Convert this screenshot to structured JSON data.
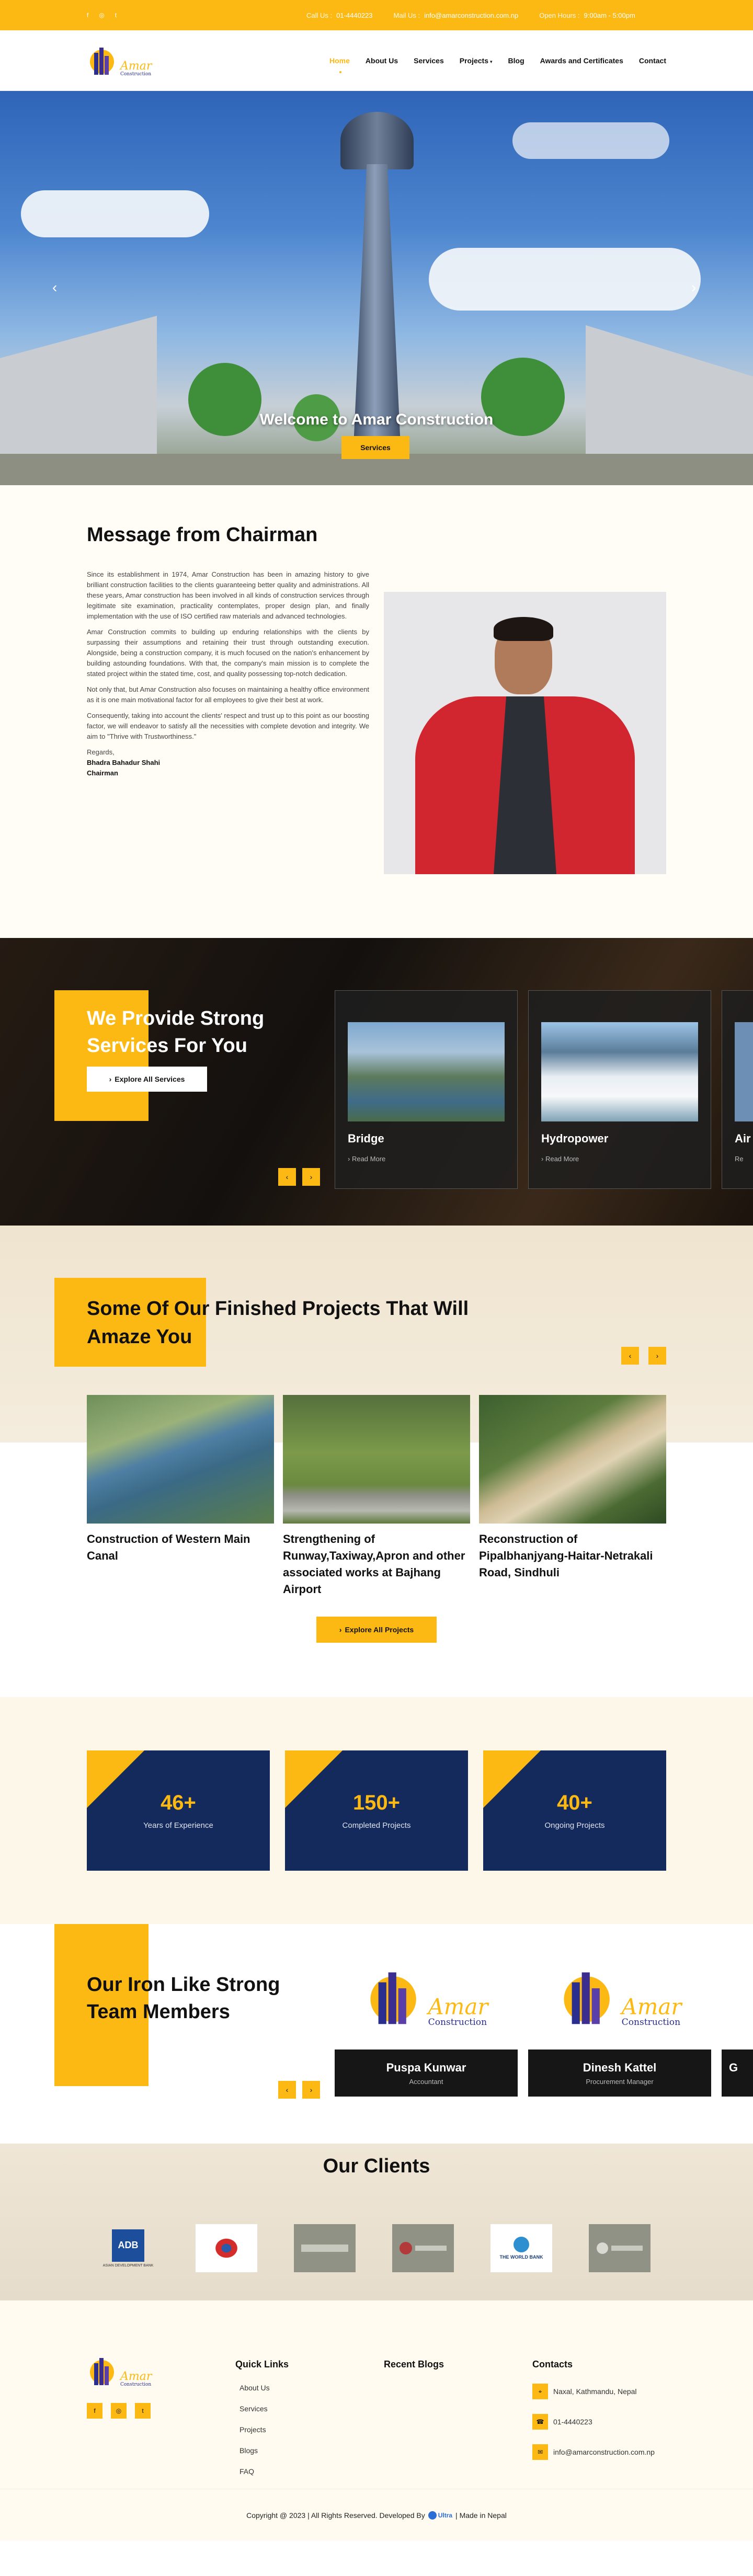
{
  "topbar": {
    "social_icons": [
      "facebook-icon",
      "instagram-icon",
      "twitter-icon"
    ],
    "call_label": "Call Us :",
    "call_value": "01-4440223",
    "mail_label": "Mail Us :",
    "mail_value": "info@amarconstruction.com.np",
    "hours_label": "Open Hours :",
    "hours_value": "9:00am - 5:00pm"
  },
  "brand": {
    "name": "Amar",
    "sub": "Construction"
  },
  "nav": {
    "home": "Home",
    "about": "About Us",
    "services": "Services",
    "projects": "Projects",
    "blog": "Blog",
    "awards": "Awards and Certificates",
    "contact": "Contact"
  },
  "hero": {
    "title": "Welcome to Amar Construction",
    "button": "Services"
  },
  "chairman": {
    "heading": "Message from Chairman",
    "p1": "Since its establishment in 1974, Amar Construction has been in amazing history to give brilliant construction facilities to the clients guaranteeing better quality and administrations. All these years, Amar construction has been involved in all kinds of construction services through legitimate site examination, practicality contemplates, proper design plan, and finally implementation with the use of ISO certified raw materials and advanced technologies.",
    "p2": "Amar Construction commits to building up enduring relationships with the clients by surpassing their assumptions and retaining their trust through outstanding execution. Alongside, being a construction company, it is much focused on the nation's enhancement by building astounding foundations. With that, the company's main mission is to complete the stated project within the stated time, cost, and quality possessing top-notch dedication.",
    "p3": "Not only that, but Amar Construction also focuses on maintaining a healthy office environment as it is one main motivational factor for all employees to give their best at work.",
    "p4": "Consequently, taking into account the clients' respect and trust up to this point as our boosting factor, we will endeavor to satisfy all the necessities with complete devotion and integrity. We aim to \"Thrive with Trustworthiness.\"",
    "regards": "Regards,",
    "name": "Bhadra Bahadur Shahi",
    "role": "Chairman"
  },
  "services": {
    "heading_yellow": "We Provide Strong",
    "heading_white": "Services For You",
    "button": "Explore All Services",
    "cards": [
      {
        "title": "Bridge",
        "link": "Read More"
      },
      {
        "title": "Hydropower",
        "link": "Read More"
      },
      {
        "title": "Air",
        "link": "Re"
      }
    ]
  },
  "projects": {
    "heading": "Some Of Our Finished Projects That Will Amaze You",
    "items": [
      {
        "title": "Construction of Western Main Canal"
      },
      {
        "title": "Strengthening of Runway,Taxiway,Apron and other associated works at Bajhang Airport"
      },
      {
        "title": "Reconstruction of Pipalbhanjyang-Haitar-Netrakali Road, Sindhuli"
      }
    ],
    "button": "Explore All Projects"
  },
  "stats": [
    {
      "value": "46+",
      "label": "Years of Experience"
    },
    {
      "value": "150+",
      "label": "Completed Projects"
    },
    {
      "value": "40+",
      "label": "Ongoing Projects"
    }
  ],
  "team": {
    "heading": "Our Iron Like Strong Team Members",
    "members": [
      {
        "name": "Puspa Kunwar",
        "role": "Accountant"
      },
      {
        "name": "Dinesh Kattel",
        "role": "Procurement Manager"
      },
      {
        "name": "G",
        "role": ""
      }
    ]
  },
  "clients": {
    "heading": "Our Clients",
    "logos": [
      {
        "label": "ADB",
        "sub": "ASIAN DEVELOPMENT BANK"
      },
      {
        "label": "",
        "sub": ""
      },
      {
        "label": "",
        "sub": ""
      },
      {
        "label": "",
        "sub": ""
      },
      {
        "label": "THE WORLD BANK",
        "sub": ""
      },
      {
        "label": "",
        "sub": ""
      }
    ]
  },
  "footer": {
    "quick_links_title": "Quick Links",
    "links": [
      "About Us",
      "Services",
      "Projects",
      "Blogs",
      "FAQ"
    ],
    "blogs_title": "Recent Blogs",
    "contacts_title": "Contacts",
    "address": "Naxal, Kathmandu, Nepal",
    "phone": "01-4440223",
    "email": "info@amarconstruction.com.np",
    "copyright": "Copyright @ 2023 | All Rights Reserved. Developed By",
    "developer": "Ultra",
    "made_in": "| Made in Nepal"
  },
  "colors": {
    "accent": "#fdb913",
    "navy": "#142a5c",
    "dark": "#161616"
  }
}
